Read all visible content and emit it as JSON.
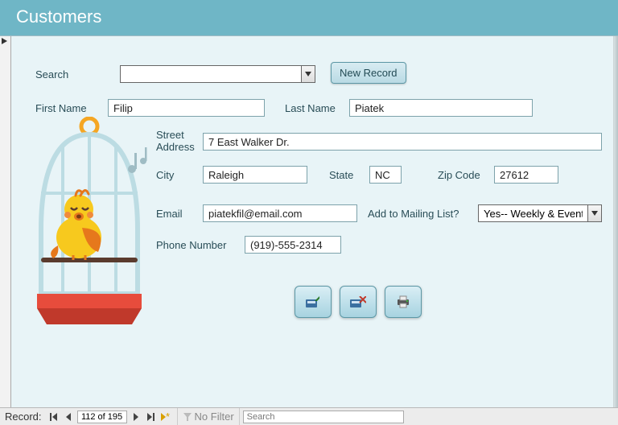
{
  "title": "Customers",
  "search": {
    "label": "Search",
    "value": "",
    "newRecord": "New Record"
  },
  "fields": {
    "firstName": {
      "label": "First Name",
      "value": "Filip"
    },
    "lastName": {
      "label": "Last Name",
      "value": "Piatek"
    },
    "street": {
      "label": "Street Address",
      "value": "7 East Walker Dr."
    },
    "city": {
      "label": "City",
      "value": "Raleigh"
    },
    "state": {
      "label": "State",
      "value": "NC"
    },
    "zip": {
      "label": "Zip Code",
      "value": "27612"
    },
    "email": {
      "label": "Email",
      "value": "piatekfil@email.com"
    },
    "mailing": {
      "label": "Add to Mailing List?",
      "value": "Yes-- Weekly & Events"
    },
    "phone": {
      "label": "Phone Number",
      "value": "(919)-555-2314"
    }
  },
  "actionIcons": {
    "save": "save-icon",
    "delete": "delete-icon",
    "print": "print-icon"
  },
  "nav": {
    "label": "Record:",
    "position": "112 of 195",
    "noFilter": "No Filter",
    "searchPlaceholder": "Search"
  }
}
